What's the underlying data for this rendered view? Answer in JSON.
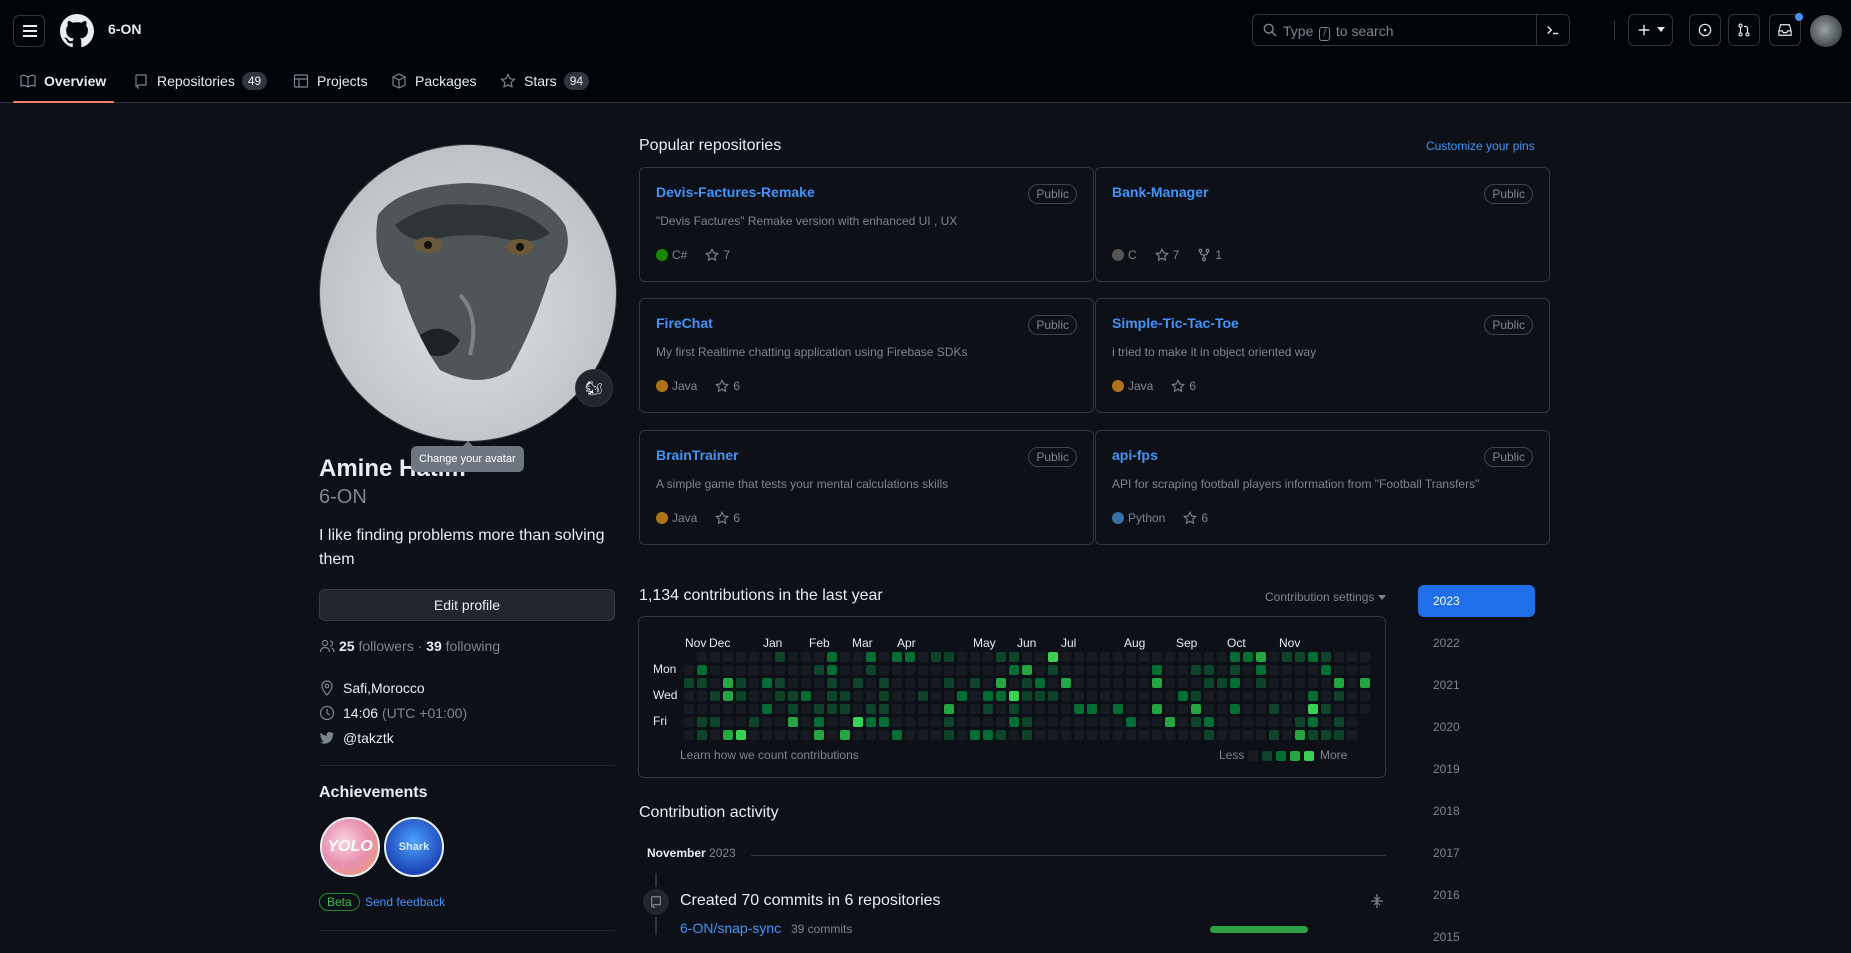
{
  "header": {
    "username": "6-ON",
    "search": {
      "prefix": "Type",
      "key": "/",
      "suffix": "to search"
    }
  },
  "tabs": [
    {
      "label": "Overview"
    },
    {
      "label": "Repositories",
      "count": "49"
    },
    {
      "label": "Projects"
    },
    {
      "label": "Packages"
    },
    {
      "label": "Stars",
      "count": "94"
    }
  ],
  "profile": {
    "avatar_emoji": "🐿",
    "tooltip": "Change your avatar",
    "full_name": "Amine Hatim",
    "login": "6-ON",
    "bio": "I like finding problems more than solving them",
    "edit_label": "Edit profile",
    "followers_count": "25",
    "followers_label": "followers",
    "separator": "·",
    "following_count": "39",
    "following_label": "following",
    "location": "Safi,Morocco",
    "local_time": "14:06",
    "timezone": "(UTC +01:00)",
    "twitter": "@takztk",
    "achievements_title": "Achievements",
    "achievement_badges": [
      "YOLO",
      "Shark"
    ],
    "beta_label": "Beta",
    "feedback_label": "Send feedback"
  },
  "pins": {
    "title": "Popular repositories",
    "customize_label": "Customize your pins",
    "items": [
      {
        "name": "Devis-Factures-Remake",
        "visibility": "Public",
        "description": "\"Devis Factures\" Remake version with enhanced UI , UX",
        "language": "C#",
        "lang_color": "#178600",
        "stars": "7",
        "forks": ""
      },
      {
        "name": "Bank-Manager",
        "visibility": "Public",
        "description": "",
        "language": "C",
        "lang_color": "#555555",
        "stars": "7",
        "forks": "1"
      },
      {
        "name": "FireChat",
        "visibility": "Public",
        "description": "My first Realtime chatting application using Firebase SDKs",
        "language": "Java",
        "lang_color": "#b07219",
        "stars": "6",
        "forks": ""
      },
      {
        "name": "Simple-Tic-Tac-Toe",
        "visibility": "Public",
        "description": "i tried to make it in object oriented way",
        "language": "Java",
        "lang_color": "#b07219",
        "stars": "6",
        "forks": ""
      },
      {
        "name": "BrainTrainer",
        "visibility": "Public",
        "description": "A simple game that tests your mental calculations skills",
        "language": "Java",
        "lang_color": "#b07219",
        "stars": "6",
        "forks": ""
      },
      {
        "name": "api-fps",
        "visibility": "Public",
        "description": "API for scraping football players information from \"Football Transfers\"",
        "language": "Python",
        "lang_color": "#3572A5",
        "stars": "6",
        "forks": ""
      }
    ]
  },
  "contributions": {
    "title": "1,134 contributions in the last year",
    "settings_label": "Contribution settings",
    "months": [
      "Nov",
      "Dec",
      "Jan",
      "Feb",
      "Mar",
      "Apr",
      "May",
      "Jun",
      "Jul",
      "Aug",
      "Sep",
      "Oct",
      "Nov"
    ],
    "day_labels": [
      "Mon",
      "Wed",
      "Fri"
    ],
    "learn_label": "Learn how we count contributions",
    "less_label": "Less",
    "more_label": "More",
    "level_colors": [
      "#161b22",
      "#0e4429",
      "#006d32",
      "#26a641",
      "#39d353"
    ]
  },
  "years": [
    "2023",
    "2022",
    "2021",
    "2020",
    "2019",
    "2018",
    "2017",
    "2016",
    "2015"
  ],
  "activity": {
    "title": "Contribution activity",
    "month": "November",
    "year": "2023",
    "event_title": "Created 70 commits in 6 repositories",
    "repo": "6-ON/snap-sync",
    "repo_commits": "39 commits"
  }
}
